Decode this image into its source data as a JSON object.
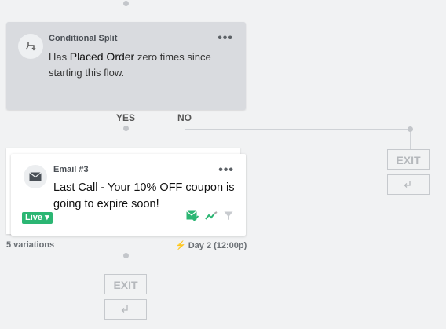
{
  "split": {
    "title": "Conditional Split",
    "text_prefix": "Has ",
    "text_highlight": "Placed Order",
    "text_suffix": " zero times since starting this flow.",
    "more_label": "•••"
  },
  "branches": {
    "yes_label": "YES",
    "no_label": "NO"
  },
  "email": {
    "title": "Email #3",
    "text": "Last Call - Your 10% OFF coupon is going to expire soon!",
    "more_label": "•••",
    "status": "Live ▾",
    "variations": "5 variations",
    "delay": "Day 2 (12:00p)"
  },
  "exits": {
    "no_branch_label": "EXIT",
    "yes_branch_label": "EXIT"
  },
  "colors": {
    "live": "#2bb673",
    "split_bg": "#d9dbdf",
    "connector": "#cfd2d6"
  }
}
